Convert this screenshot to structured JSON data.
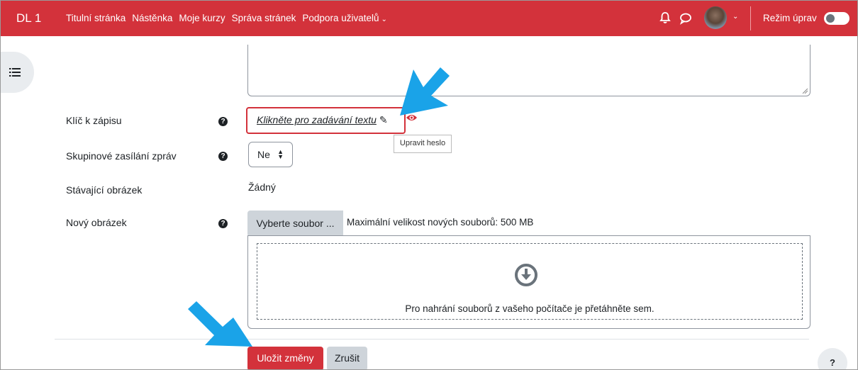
{
  "navbar": {
    "brand": "DL 1",
    "links": [
      "Titulní stránka",
      "Nástěnka",
      "Moje kurzy",
      "Správa stránek",
      "Podpora uživatelů"
    ],
    "edit_mode_label": "Režim úprav",
    "edit_mode_on": false,
    "bg_color": "#d3323b",
    "icons": [
      "bell-icon",
      "chat-bubble-icon",
      "avatar",
      "chevron-down-icon"
    ]
  },
  "form": {
    "enrolment_key": {
      "label": "Klíč k zápisu",
      "link_text": "Klikněte pro zadávání textu",
      "tooltip": "Upravit heslo"
    },
    "group_messaging": {
      "label": "Skupinové zasílání zpráv",
      "selected": "Ne"
    },
    "current_image": {
      "label": "Stávající obrázek",
      "value": "Žádný"
    },
    "new_image": {
      "label": "Nový obrázek",
      "choose_button": "Vyberte soubor ...",
      "max_size": "Maximální velikost nových souborů: 500 MB",
      "drop_text": "Pro nahrání souborů z vašeho počítače je přetáhněte sem."
    }
  },
  "actions": {
    "save": "Uložit změny",
    "cancel": "Zrušit"
  },
  "help_fab": "?",
  "colors": {
    "accent": "#d3323b",
    "annotation_arrow": "#1aa3e8"
  }
}
